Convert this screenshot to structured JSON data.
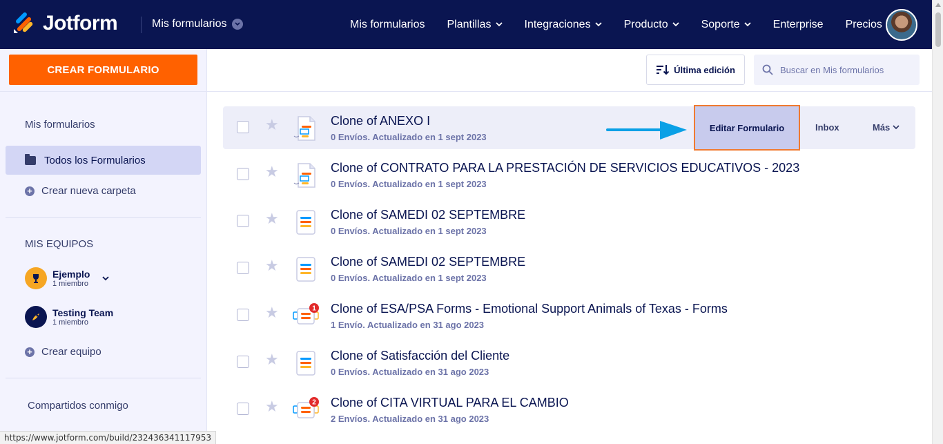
{
  "brand": {
    "name": "Jotform"
  },
  "nav": {
    "my_forms_dropdown": "Mis formularios",
    "links": [
      {
        "label": "Mis formularios",
        "has_menu": false
      },
      {
        "label": "Plantillas",
        "has_menu": true
      },
      {
        "label": "Integraciones",
        "has_menu": true
      },
      {
        "label": "Producto",
        "has_menu": true
      },
      {
        "label": "Soporte",
        "has_menu": true
      },
      {
        "label": "Enterprise",
        "has_menu": false
      },
      {
        "label": "Precios",
        "has_menu": false
      }
    ]
  },
  "sidebar": {
    "create_button": "CREAR FORMULARIO",
    "my_forms_heading": "Mis formularios",
    "all_forms": "Todos los Formularios",
    "new_folder": "Crear nueva carpeta",
    "teams_heading": "MIS EQUIPOS",
    "teams": [
      {
        "name": "Ejemplo",
        "members": "1 miembro"
      },
      {
        "name": "Testing Team",
        "members": "1 miembro"
      }
    ],
    "create_team": "Crear equipo",
    "shared_with_me": "Compartidos conmigo"
  },
  "toolbar": {
    "sort_label": "Última edición",
    "search_placeholder": "Buscar en Mis formularios"
  },
  "forms": [
    {
      "title": "Clone of ANEXO I",
      "meta": "0 Envíos. Actualizado en 1 sept 2023",
      "badge": ""
    },
    {
      "title": "Clone of CONTRATO PARA LA PRESTACIÓN DE SERVICIOS EDUCATIVOS - 2023",
      "meta": "0 Envíos. Actualizado en 1 sept 2023",
      "badge": ""
    },
    {
      "title": "Clone of SAMEDI 02 SEPTEMBRE",
      "meta": "0 Envíos. Actualizado en 1 sept 2023",
      "badge": ""
    },
    {
      "title": "Clone of SAMEDI 02 SEPTEMBRE",
      "meta": "0 Envíos. Actualizado en 1 sept 2023",
      "badge": ""
    },
    {
      "title": "Clone of ESA/PSA Forms - Emotional Support Animals of Texas - Forms",
      "meta": "1 Envío. Actualizado en 31 ago 2023",
      "badge": "1"
    },
    {
      "title": "Clone of Satisfacción del Cliente",
      "meta": "0 Envíos. Actualizado en 31 ago 2023",
      "badge": ""
    },
    {
      "title": "Clone of CITA VIRTUAL PARA EL CAMBIO",
      "meta": "2 Envíos. Actualizado en 31 ago 2023",
      "badge": "2"
    }
  ],
  "row_actions": {
    "edit": "Editar Formulario",
    "inbox": "Inbox",
    "more": "Más"
  },
  "status_url": "https://www.jotform.com/build/232436341117953",
  "colors": {
    "navy": "#0a1551",
    "orange": "#ff6100",
    "sidebar_bg": "#f3f3fe",
    "highlight_border": "#f07a30",
    "arrow": "#0aa0e6"
  }
}
